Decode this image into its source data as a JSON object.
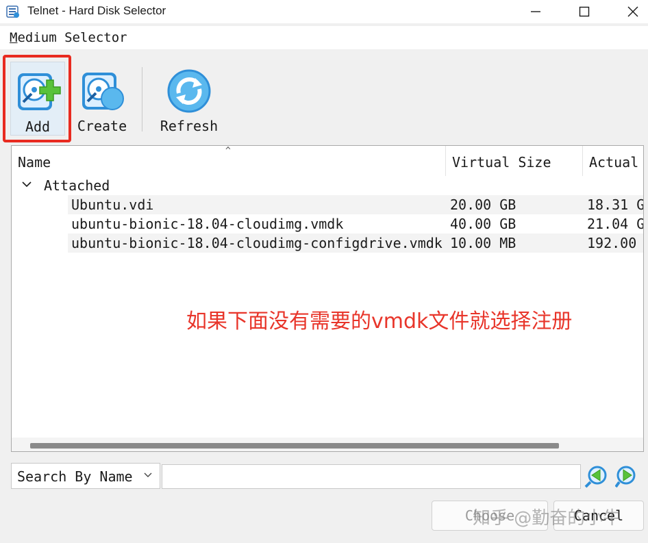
{
  "window": {
    "title": "Telnet - Hard Disk Selector"
  },
  "menu": {
    "title_first": "M",
    "title_rest": "edium Selector"
  },
  "toolbar": {
    "add_label": "Add",
    "create_label": "Create",
    "refresh_label": "Refresh"
  },
  "tree": {
    "columns": [
      "Name",
      "Virtual Size",
      "Actual"
    ],
    "group_label": "Attached",
    "rows": [
      {
        "name": "Ubuntu.vdi",
        "virtual": "20.00 GB",
        "actual": "18.31 G"
      },
      {
        "name": "ubuntu-bionic-18.04-cloudimg.vmdk",
        "virtual": "40.00 GB",
        "actual": "21.04 G"
      },
      {
        "name": "ubuntu-bionic-18.04-cloudimg-configdrive.vmdk",
        "virtual": "10.00 MB",
        "actual": "192.00"
      }
    ]
  },
  "annotation": "如果下面没有需要的vmdk文件就选择注册",
  "search": {
    "mode": "Search By Name",
    "value": ""
  },
  "buttons": {
    "choose": "Choose",
    "cancel": "Cancel"
  },
  "watermark": "知乎 @勤奋的小牛",
  "colors": {
    "highlight": "#e82b20",
    "annotation": "#e8352a",
    "icon_blue": "#2f8fd8",
    "icon_green": "#58c23a"
  },
  "icons": {
    "add": "disk-add-icon",
    "create": "disk-create-icon",
    "refresh": "refresh-icon",
    "prev": "search-previous-icon",
    "next": "search-next-icon"
  }
}
